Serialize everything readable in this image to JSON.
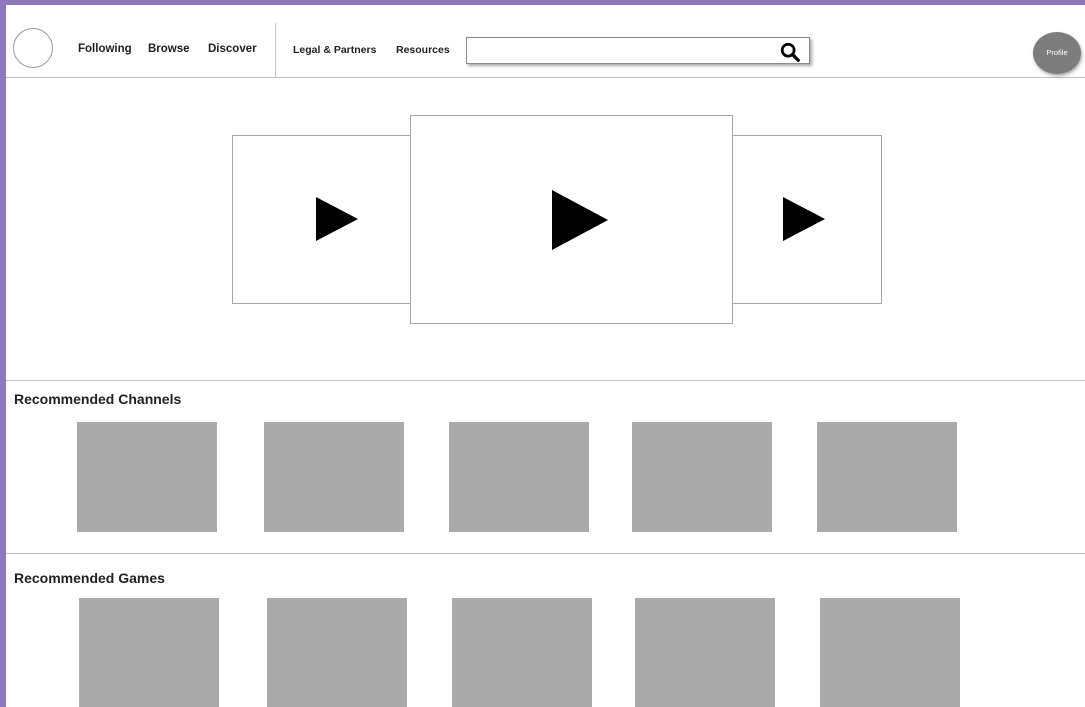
{
  "header": {
    "nav_left": [
      "Following",
      "Browse",
      "Discover"
    ],
    "nav_right": [
      "Legal & Partners",
      "Resources"
    ],
    "search": {
      "value": "",
      "placeholder": "",
      "icon": "search-icon"
    },
    "profile_label": "Profile"
  },
  "carousel": {
    "items": [
      {
        "icon": "play-icon"
      },
      {
        "icon": "play-icon"
      },
      {
        "icon": "play-icon"
      }
    ]
  },
  "sections": {
    "channels": {
      "title": "Recommended Channels",
      "tile_count": 5
    },
    "games": {
      "title": "Recommended Games",
      "tile_count": 5
    }
  },
  "colors": {
    "outer_border": "#8e78b8",
    "placeholder_tile": "#aaaaaa",
    "profile_bg": "#7d7d7d"
  }
}
